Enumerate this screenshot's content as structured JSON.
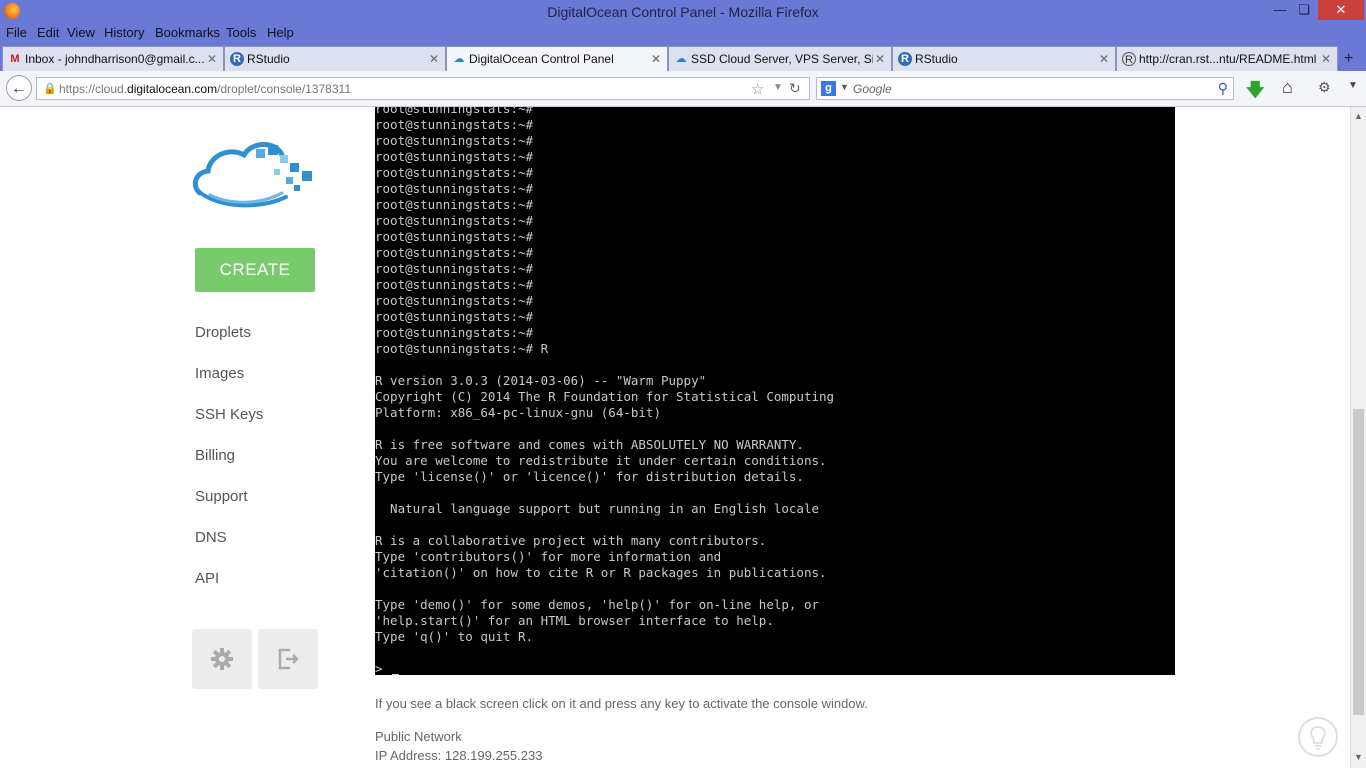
{
  "window": {
    "title": "DigitalOcean Control Panel - Mozilla Firefox",
    "controls": {
      "minimize": "—",
      "maximize": "❏",
      "close": "✕"
    }
  },
  "menu": [
    "File",
    "Edit",
    "View",
    "History",
    "Bookmarks",
    "Tools",
    "Help"
  ],
  "tabs": [
    {
      "label": "Inbox - johndharrison0@gmail.c...",
      "icon": "gmail-icon",
      "glyph": "M",
      "active": false
    },
    {
      "label": "RStudio",
      "icon": "r-icon",
      "glyph": "R",
      "active": false
    },
    {
      "label": "DigitalOcean Control Panel",
      "icon": "cloud-icon",
      "glyph": "☁",
      "active": true
    },
    {
      "label": "SSD Cloud Server, VPS Server, Si...",
      "icon": "cloud-icon",
      "glyph": "☁",
      "active": false
    },
    {
      "label": "RStudio",
      "icon": "r-icon",
      "glyph": "R",
      "active": false
    },
    {
      "label": "http://cran.rst...ntu/README.html",
      "icon": "cran-icon",
      "glyph": "R",
      "active": false
    }
  ],
  "tab_close": "✕",
  "new_tab": "+",
  "nav": {
    "url_prefix": "https://cloud.",
    "url_domain": "digitalocean.com",
    "url_path": "/droplet/console/1378311",
    "search_placeholder": "Google"
  },
  "sidebar": {
    "create_label": "CREATE",
    "items": [
      "Droplets",
      "Images",
      "SSH Keys",
      "Billing",
      "Support",
      "DNS",
      "API"
    ]
  },
  "console": {
    "lines": [
      "root@stunningstats:~#",
      "root@stunningstats:~#",
      "root@stunningstats:~#",
      "root@stunningstats:~#",
      "root@stunningstats:~#",
      "root@stunningstats:~#",
      "root@stunningstats:~#",
      "root@stunningstats:~#",
      "root@stunningstats:~#",
      "root@stunningstats:~#",
      "root@stunningstats:~#",
      "root@stunningstats:~#",
      "root@stunningstats:~#",
      "root@stunningstats:~#",
      "root@stunningstats:~#",
      "root@stunningstats:~# R",
      "",
      "R version 3.0.3 (2014-03-06) -- \"Warm Puppy\"",
      "Copyright (C) 2014 The R Foundation for Statistical Computing",
      "Platform: x86_64-pc-linux-gnu (64-bit)",
      "",
      "R is free software and comes with ABSOLUTELY NO WARRANTY.",
      "You are welcome to redistribute it under certain conditions.",
      "Type 'license()' or 'licence()' for distribution details.",
      "",
      "  Natural language support but running in an English locale",
      "",
      "R is a collaborative project with many contributors.",
      "Type 'contributors()' for more information and",
      "'citation()' on how to cite R or R packages in publications.",
      "",
      "Type 'demo()' for some demos, 'help()' for on-line help, or",
      "'help.start()' for an HTML browser interface to help.",
      "Type 'q()' to quit R.",
      "",
      ">"
    ]
  },
  "help_text": "If you see a black screen click on it and press any key to activate the console window.",
  "network": {
    "label": "Public Network",
    "ip_line": "IP Address: 128.199.255.233"
  },
  "colors": {
    "title_bar": "#6b79d6",
    "create_button": "#79c96d",
    "console_bg": "#000000",
    "console_text": "#c8c8c8"
  }
}
